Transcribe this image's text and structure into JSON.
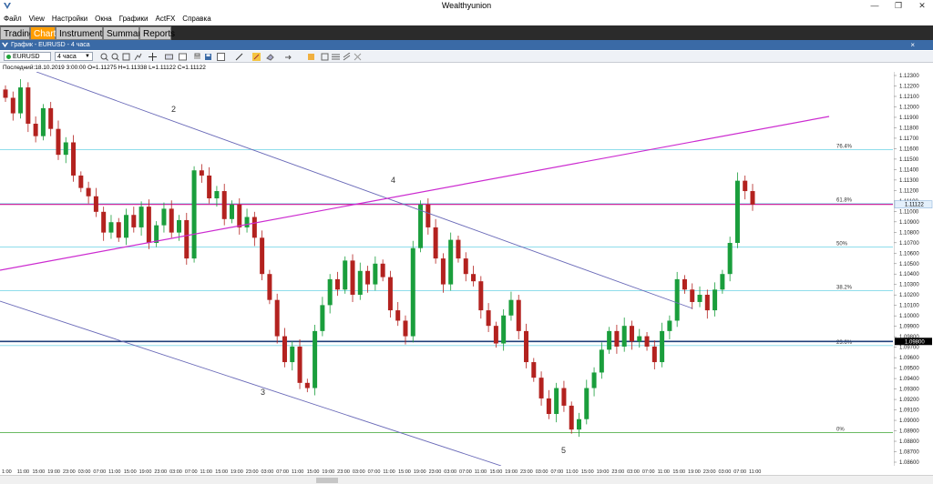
{
  "window": {
    "title": "Wealthyunion"
  },
  "menu": [
    "Файл",
    "View",
    "Настройки",
    "Окна",
    "Графики",
    "ActFX",
    "Справка"
  ],
  "tabs": [
    {
      "label": "Trading",
      "active": false
    },
    {
      "label": "Charts",
      "active": true
    },
    {
      "label": "Instruments",
      "active": false
    },
    {
      "label": "Summary",
      "active": false
    },
    {
      "label": "Reports",
      "active": false
    }
  ],
  "chart_window": {
    "title": "График - EURUSD - 4 часа",
    "close_label": "×"
  },
  "toolbar": {
    "symbol": "EURUSD",
    "timeframe": "4 часа"
  },
  "info": "Последний:18.10.2019 3:00:00 O=1.11275 H=1.11338 L=1.11122 C=1.11122",
  "chart_data": {
    "type": "candlestick",
    "symbol": "EURUSD",
    "timeframe": "4 часа",
    "ylim": [
      1.086,
      1.124
    ],
    "y_ticks": [
      "1.12300",
      "1.12200",
      "1.12100",
      "1.12000",
      "1.11900",
      "1.11800",
      "1.11700",
      "1.11600",
      "1.11500",
      "1.11400",
      "1.11300",
      "1.11200",
      "1.11100",
      "1.11000",
      "1.10900",
      "1.10800",
      "1.10700",
      "1.10600",
      "1.10500",
      "1.10400",
      "1.10300",
      "1.10200",
      "1.10100",
      "1.10000",
      "1.09900",
      "1.09800",
      "1.09700",
      "1.09600",
      "1.09500",
      "1.09400",
      "1.09300",
      "1.09200",
      "1.09100",
      "1.09000",
      "1.08900",
      "1.08800",
      "1.08700",
      "1.08600"
    ],
    "x_ticks": [
      "1:00",
      "11:00",
      "15:00",
      "19:00",
      "23:00",
      "03:00",
      "07:00",
      "11:00",
      "15:00",
      "19:00",
      "23:00",
      "03:00",
      "07:00",
      "11:00",
      "15:00",
      "19:00",
      "23:00",
      "03:00",
      "07:00",
      "11:00",
      "15:00",
      "19:00",
      "23:00",
      "03:00",
      "07:00",
      "11:00",
      "15:00",
      "19:00",
      "23:00",
      "03:00",
      "07:00",
      "11:00",
      "15:00",
      "19:00",
      "23:00",
      "03:00",
      "07:00",
      "11:00",
      "15:00",
      "19:00",
      "23:00",
      "03:00",
      "07:00",
      "11:00",
      "15:00",
      "19:00",
      "23:00",
      "03:00",
      "07:00",
      "11:00"
    ],
    "last_price": "1.11122",
    "highlight_price_label": "1.09800",
    "fib_levels": [
      {
        "label": "76.4%",
        "price": 1.1165
      },
      {
        "label": "61.8%",
        "price": 1.1113
      },
      {
        "label": "50%",
        "price": 1.1071
      },
      {
        "label": "38.2%",
        "price": 1.1029
      },
      {
        "label": "23.6%",
        "price": 1.0976
      },
      {
        "label": "0%",
        "price": 1.0892
      }
    ],
    "wave_labels": [
      "2",
      "3",
      "4",
      "5"
    ],
    "closes": [
      1.1215,
      1.12,
      1.1225,
      1.119,
      1.1178,
      1.1205,
      1.1185,
      1.116,
      1.1172,
      1.114,
      1.1128,
      1.112,
      1.1105,
      1.1085,
      1.1095,
      1.108,
      1.1102,
      1.109,
      1.111,
      1.1075,
      1.1092,
      1.1108,
      1.1085,
      1.1097,
      1.106,
      1.1145,
      1.114,
      1.1118,
      1.1125,
      1.1098,
      1.1112,
      1.109,
      1.11,
      1.108,
      1.1045,
      1.102,
      1.0985,
      1.096,
      1.0975,
      1.094,
      1.0935,
      1.099,
      1.1015,
      1.104,
      1.103,
      1.1058,
      1.1025,
      1.1048,
      1.1035,
      1.1055,
      1.1042,
      1.101,
      1.1,
      1.0985,
      1.107,
      1.1112,
      1.109,
      1.106,
      1.1035,
      1.1078,
      1.106,
      1.1045,
      1.1038,
      1.101,
      1.0995,
      1.0978,
      1.1005,
      1.102,
      1.099,
      1.096,
      1.0945,
      1.0925,
      1.091,
      1.0935,
      1.0918,
      1.0895,
      1.0905,
      1.0935,
      1.095,
      1.0972,
      1.099,
      1.0975,
      1.0995,
      1.098,
      1.0985,
      1.0975,
      1.096,
      1.099,
      1.1,
      1.104,
      1.103,
      1.1018,
      1.1025,
      1.101,
      1.103,
      1.1045,
      1.1075,
      1.1135,
      1.1125,
      1.1112
    ]
  }
}
